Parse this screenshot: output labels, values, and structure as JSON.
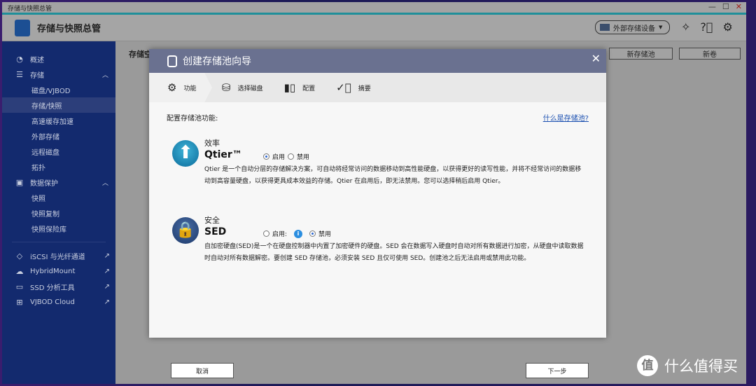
{
  "window": {
    "title": "存储与快照总管",
    "controls": [
      "—",
      "☐",
      "✕"
    ]
  },
  "app": {
    "title": "存储与快照总管",
    "external_storage_label": "外部存储设备"
  },
  "sidebar": {
    "items": [
      {
        "label": "概述",
        "icon": "dashboard-icon"
      },
      {
        "label": "存储",
        "icon": "storage-icon"
      },
      {
        "label": "磁盘/VJBOD"
      },
      {
        "label": "存储/快照",
        "selected": true
      },
      {
        "label": "高速缓存加速"
      },
      {
        "label": "外部存储"
      },
      {
        "label": "远程磁盘"
      },
      {
        "label": "拓扑"
      },
      {
        "label": "数据保护",
        "icon": "data-protection-icon"
      },
      {
        "label": "快照"
      },
      {
        "label": "快照复制"
      },
      {
        "label": "快照保险库"
      },
      {
        "label": "iSCSI 与光纤通道",
        "icon": "iscsi-icon"
      },
      {
        "label": "HybridMount",
        "icon": "cloud-icon"
      },
      {
        "label": "SSD 分析工具",
        "icon": "ssd-icon"
      },
      {
        "label": "VJBOD Cloud",
        "icon": "vjbod-icon"
      }
    ]
  },
  "main": {
    "breadcrumb": "存储空",
    "new_pool": "新存储池",
    "new_volume": "新卷"
  },
  "dialog": {
    "title": "创建存储池向导",
    "steps": [
      {
        "label": "功能",
        "active": true
      },
      {
        "label": "选择磁盘"
      },
      {
        "label": "配置"
      },
      {
        "label": "摘要"
      }
    ],
    "config_label": "配置存储池功能:",
    "help_link": "什么是存储池?",
    "features": [
      {
        "category": "效率",
        "name": "Qtier™",
        "enable": "启用",
        "disable": "禁用",
        "selected": "enable",
        "desc": "Qtier 是一个自动分层的存储解决方案，可自动将经常访问的数据移动到高性能硬盘，以获得更好的读写性能，并将不经常访问的数据移动到高容量硬盘，以获得更具成本效益的存储。Qtier 在启用后，即无法禁用。您可以选择稍后启用 Qtier。"
      },
      {
        "category": "安全",
        "name": "SED",
        "enable": "启用:",
        "disable": "禁用",
        "selected": "disable",
        "desc": "自加密硬盘(SED)是一个在硬盘控制器中内置了加密硬件的硬盘。SED 会在数据写入硬盘时自动对所有数据进行加密，从硬盘中读取数据时自动对所有数据解密。要创建 SED 存储池，必须安装 SED 且仅可使用 SED。创建池之后无法启用或禁用此功能。"
      }
    ],
    "cancel": "取消",
    "next": "下一步"
  },
  "watermark": {
    "badge": "值",
    "text": "什么值得买"
  }
}
